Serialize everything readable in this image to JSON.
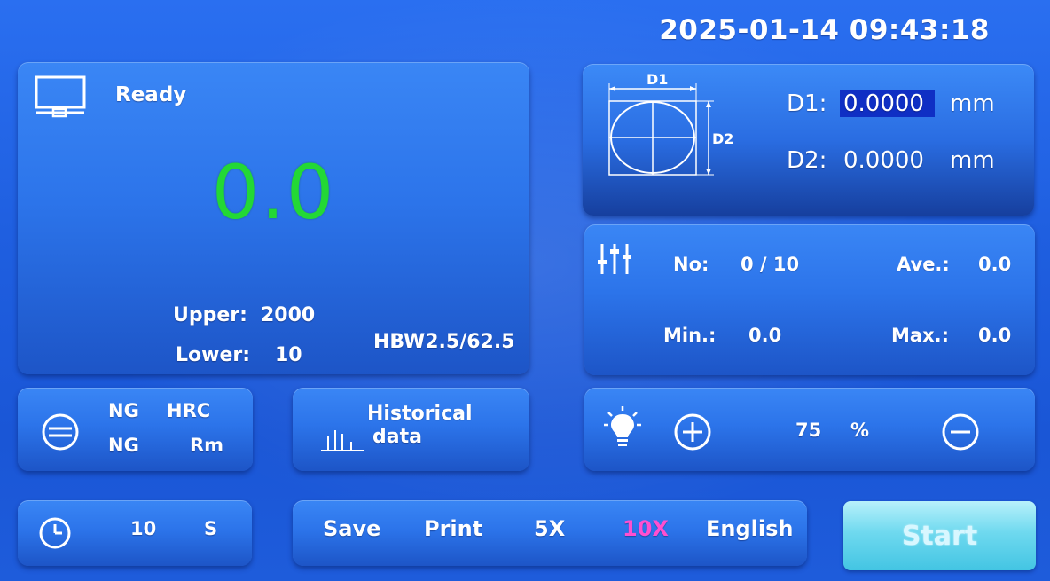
{
  "header": {
    "datetime": "2025-01-14 09:43:18"
  },
  "main": {
    "status": "Ready",
    "reading": "0.0",
    "upper_label": "Upper:",
    "upper_value": "2000",
    "lower_label": "Lower:",
    "lower_value": "10",
    "scale": "HBW2.5/62.5"
  },
  "diameter": {
    "diagram_d1": "D1",
    "diagram_d2": "D2",
    "d1_label": "D1:",
    "d1_value": "0.0000",
    "d2_label": "D2:",
    "d2_value": "0.0000",
    "unit": "mm"
  },
  "stats": {
    "no_label": "No:",
    "no_value": "0 / 10",
    "ave_label": "Ave.:",
    "ave_value": "0.0",
    "min_label": "Min.:",
    "min_value": "0.0",
    "max_label": "Max.:",
    "max_value": "0.0"
  },
  "conversion": {
    "row1_status": "NG",
    "row1_scale": "HRC",
    "row2_status": "NG",
    "row2_scale": "Rm"
  },
  "history": {
    "line1": "Historical",
    "line2": "data"
  },
  "light": {
    "value": "75",
    "unit": "%"
  },
  "timer": {
    "value": "10",
    "unit": "S"
  },
  "actions": {
    "save": "Save",
    "print": "Print",
    "zoom5": "5X",
    "zoom10": "10X",
    "language": "English"
  },
  "start": {
    "label": "Start"
  },
  "colors": {
    "reading": "#23d835",
    "active_zoom": "#ff4fd0",
    "highlight": "#0f2fc4",
    "start_button": "#6fd9ef"
  },
  "icons": {
    "monitor": "monitor-icon",
    "sliders": "sliders-icon",
    "conversion": "conversion-icon",
    "chart": "bar-chart-icon",
    "bulb": "light-bulb-icon",
    "plus": "plus-circle-icon",
    "minus": "minus-circle-icon",
    "clock": "clock-icon"
  }
}
